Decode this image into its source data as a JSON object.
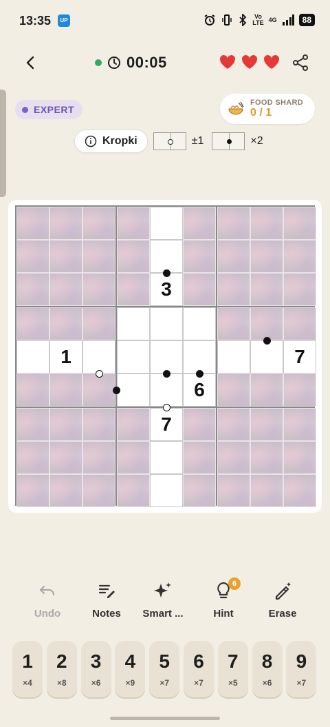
{
  "status_bar": {
    "time": "13:35",
    "app_badge": "云闪付",
    "volte": "Vo\nLTE",
    "network": "4G",
    "battery": "88"
  },
  "header": {
    "timer": "00:05",
    "lives": 3
  },
  "difficulty": "EXPERT",
  "food_shard": {
    "label": "FOOD SHARD",
    "value": "0 / 1"
  },
  "rules": {
    "name": "Kropki",
    "white_rule": "±1",
    "black_rule": "×2"
  },
  "board": {
    "open_cells": [
      [
        0,
        4
      ],
      [
        1,
        4
      ],
      [
        2,
        4
      ],
      [
        3,
        3
      ],
      [
        3,
        4
      ],
      [
        3,
        5
      ],
      [
        4,
        0
      ],
      [
        4,
        1
      ],
      [
        4,
        2
      ],
      [
        4,
        3
      ],
      [
        4,
        4
      ],
      [
        4,
        5
      ],
      [
        4,
        6
      ],
      [
        4,
        7
      ],
      [
        4,
        8
      ],
      [
        5,
        3
      ],
      [
        5,
        4
      ],
      [
        5,
        5
      ],
      [
        6,
        4
      ],
      [
        7,
        4
      ],
      [
        8,
        4
      ]
    ],
    "givens": [
      {
        "row": 2,
        "col": 4,
        "value": "3"
      },
      {
        "row": 4,
        "col": 1,
        "value": "1"
      },
      {
        "row": 4,
        "col": 8,
        "value": "7"
      },
      {
        "row": 5,
        "col": 5,
        "value": "6"
      },
      {
        "row": 6,
        "col": 4,
        "value": "7"
      }
    ],
    "dots": [
      {
        "type": "black",
        "between": [
          [
            1,
            4
          ],
          [
            2,
            4
          ]
        ]
      },
      {
        "type": "black",
        "between": [
          [
            3,
            7
          ],
          [
            4,
            7
          ]
        ]
      },
      {
        "type": "white",
        "between": [
          [
            4,
            2
          ],
          [
            5,
            2
          ]
        ]
      },
      {
        "type": "black",
        "between": [
          [
            4,
            5
          ],
          [
            5,
            5
          ]
        ]
      },
      {
        "type": "black",
        "between": [
          [
            4,
            4
          ],
          [
            5,
            4
          ]
        ]
      },
      {
        "type": "black",
        "between": [
          [
            5,
            2
          ],
          [
            5,
            3
          ]
        ]
      },
      {
        "type": "white",
        "between": [
          [
            5,
            4
          ],
          [
            6,
            4
          ]
        ]
      }
    ]
  },
  "tools": [
    {
      "label": "Undo",
      "icon": "undo-icon",
      "disabled": true
    },
    {
      "label": "Notes",
      "icon": "notes-icon",
      "disabled": false
    },
    {
      "label": "Smart ...",
      "icon": "sparkle-icon",
      "disabled": false
    },
    {
      "label": "Hint",
      "icon": "lightbulb-icon",
      "disabled": false,
      "badge": "6"
    },
    {
      "label": "Erase",
      "icon": "eraser-icon",
      "disabled": false
    }
  ],
  "numpad": [
    {
      "digit": "1",
      "count": "×4"
    },
    {
      "digit": "2",
      "count": "×8"
    },
    {
      "digit": "3",
      "count": "×6"
    },
    {
      "digit": "4",
      "count": "×9"
    },
    {
      "digit": "5",
      "count": "×7"
    },
    {
      "digit": "6",
      "count": "×7"
    },
    {
      "digit": "7",
      "count": "×5"
    },
    {
      "digit": "8",
      "count": "×6"
    },
    {
      "digit": "9",
      "count": "×7"
    }
  ],
  "colors": {
    "background": "#f2eee4",
    "heart": "#e53935",
    "timer_dot": "#2eaa62",
    "difficulty": "#6b55b5",
    "food_value": "#d99a2b"
  }
}
